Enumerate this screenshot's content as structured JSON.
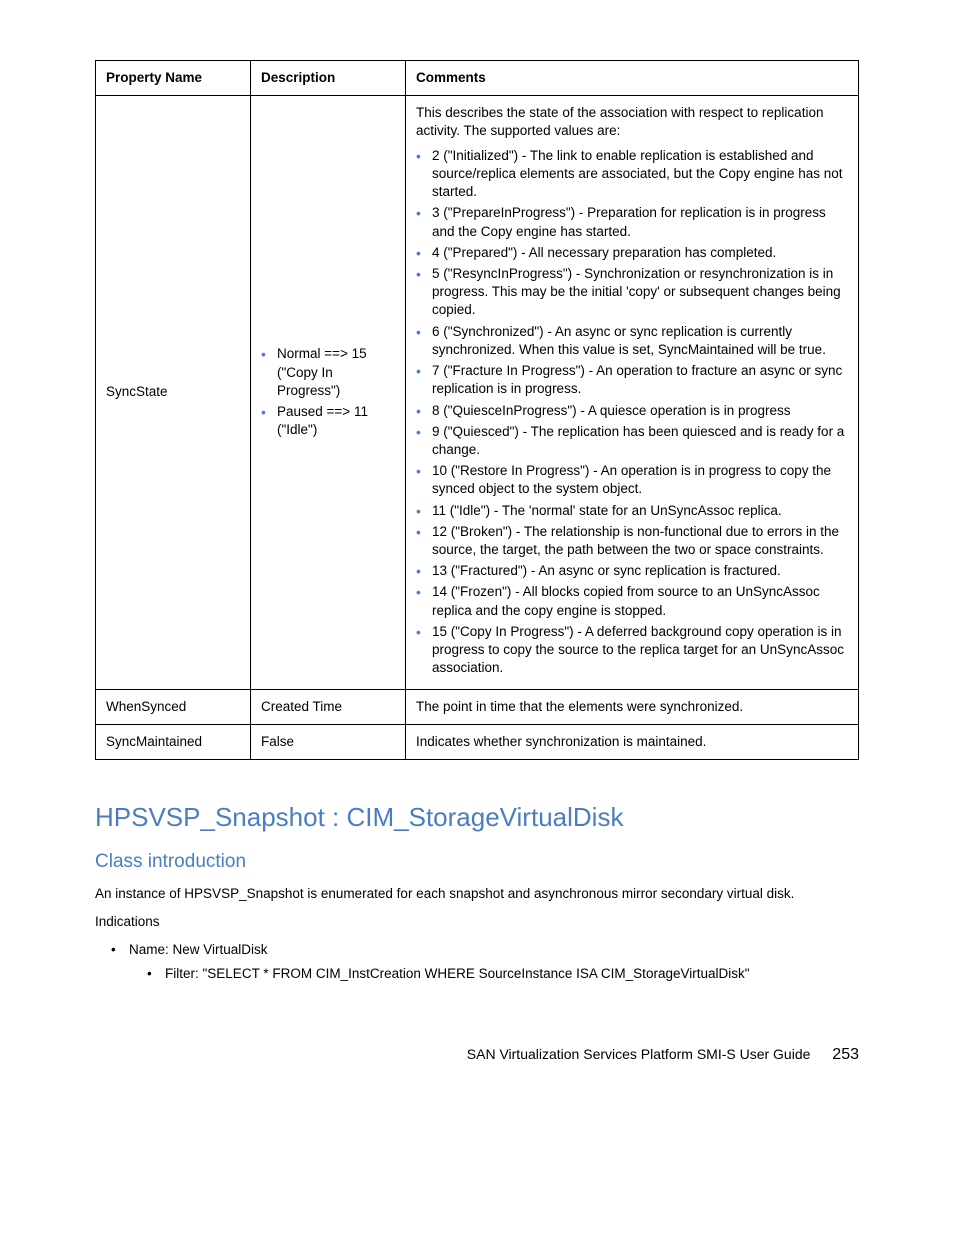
{
  "table": {
    "headers": [
      "Property Name",
      "Description",
      "Comments"
    ],
    "rows": [
      {
        "property": "SyncState",
        "description_items": [
          "Normal ==> 15 (\"Copy In Progress\")",
          "Paused ==> 11 (\"Idle\")"
        ],
        "comments_intro": "This describes the state of the association with respect to replication activity. The supported values are:",
        "comments_items": [
          "2 (\"Initialized\") - The link to enable replication is established and source/replica elements are associated, but the Copy engine has not started.",
          "3 (\"PrepareInProgress\") - Preparation for replication is in progress and the Copy engine has started.",
          "4 (\"Prepared\") - All necessary preparation has completed.",
          "5 (\"ResyncInProgress\") - Synchronization or resynchronization is in progress. This may be the initial 'copy' or subsequent changes being copied.",
          "6 (\"Synchronized\") - An async or sync replication is currently synchronized. When this value is set, SyncMaintained will be true.",
          "7 (\"Fracture In Progress\") - An operation to fracture an async or sync replication is in progress.",
          "8 (\"QuiesceInProgress\") - A quiesce operation is in progress",
          "9 (\"Quiesced\") - The replication has been quiesced and is ready for a change.",
          "10 (\"Restore In Progress\") - An operation is in progress to copy the synced object to the system object.",
          "11 (\"Idle\") - The 'normal' state for an UnSyncAssoc replica.",
          "12 (\"Broken\") - The relationship is non-functional due to errors in the source, the target, the path between the two or space constraints.",
          "13 (\"Fractured\") - An async or sync replication is fractured.",
          "14 (\"Frozen\") - All blocks copied from source to an UnSyncAssoc replica and the copy engine is stopped.",
          "15 (\"Copy In Progress\") - A deferred background copy operation is in progress to copy the source to the replica target for an UnSyncAssoc association."
        ]
      },
      {
        "property": "WhenSynced",
        "description": "Created Time",
        "comments": "The point in time that the elements were synchronized."
      },
      {
        "property": "SyncMaintained",
        "description": "False",
        "comments": "Indicates whether synchronization is maintained."
      }
    ]
  },
  "section": {
    "title": "HPSVSP_Snapshot : CIM_StorageVirtualDisk",
    "subtitle": "Class introduction",
    "intro": "An instance of HPSVSP_Snapshot is enumerated for each snapshot and asynchronous mirror secondary virtual disk.",
    "indications_label": "Indications",
    "indications": {
      "name": "Name: New VirtualDisk",
      "filter": "Filter: \"SELECT * FROM CIM_InstCreation WHERE SourceInstance ISA CIM_StorageVirtualDisk\""
    }
  },
  "footer": {
    "title": "SAN Virtualization Services Platform SMI-S User Guide",
    "page": "253"
  }
}
